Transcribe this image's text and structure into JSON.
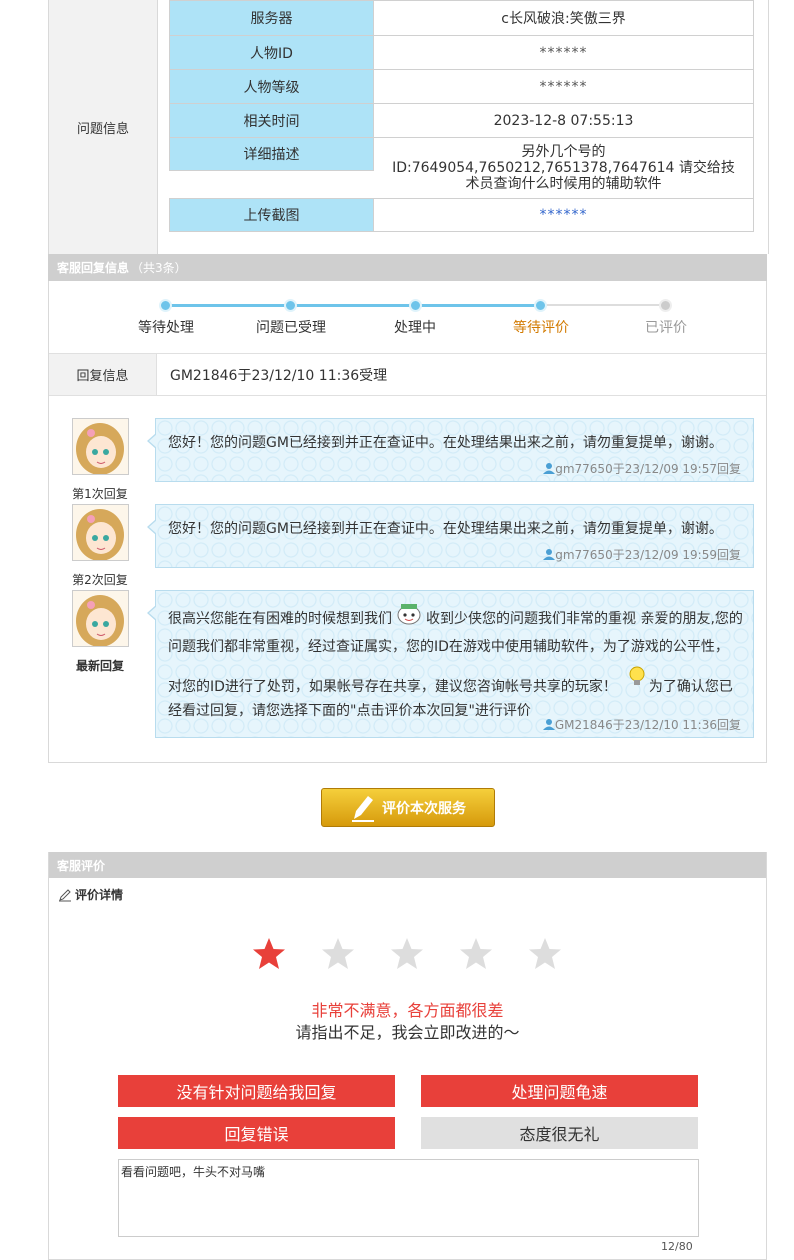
{
  "question": {
    "section_label": "问题信息",
    "rows": [
      {
        "key": "服务器",
        "value": "c长风破浪:笑傲三界"
      },
      {
        "key": "人物ID",
        "value": "******"
      },
      {
        "key": "人物等级",
        "value": "******"
      },
      {
        "key": "相关时间",
        "value": "2023-12-8 07:55:13"
      },
      {
        "key": "详细描述",
        "value_lines": [
          "另外几个号的",
          "ID:7649054,7650212,7651378,7647614 请交给技",
          "术员查询什么时候用的辅助软件"
        ]
      },
      {
        "key": "上传截图",
        "value": "******"
      }
    ]
  },
  "reply": {
    "header_title": "客服回复信息",
    "header_count": "（共3条）",
    "progress": {
      "steps": [
        "等待处理",
        "问题已受理",
        "处理中",
        "等待评价",
        "已评价"
      ],
      "current_step": 4
    },
    "info_label": "回复信息",
    "info_value": "GM21846于23/12/10 11:36受理",
    "messages": [
      {
        "label": "第1次回复",
        "text": "您好！您的问题GM已经接到并正在查证中。在处理结果出来之前，请勿重复提单，谢谢。",
        "author": "gm77650",
        "meta": "于23/12/09 19:57回复"
      },
      {
        "label": "第2次回复",
        "text": "您好！您的问题GM已经接到并正在查证中。在处理结果出来之前，请勿重复提单，谢谢。",
        "author": "gm77650",
        "meta": "于23/12/09 19:59回复"
      },
      {
        "label": "最新回复",
        "line1a": "很高兴您能在有困难的时候想到我们",
        "line1b": "收到少侠您的问题我们非常的重视 亲爱的朋友,您的",
        "line2": "问题我们都非常重视，经过查证属实，您的ID在游戏中使用辅助软件，为了游戏的公平性，",
        "line3a": "对您的ID进行了处罚，如果帐号存在共享，建议您咨询帐号共享的玩家！",
        "line3b": "为了确认您已",
        "line4": "经看过回复，请您选择下面的\"点击评价本次回复\"进行评价",
        "author": "GM21846",
        "meta": "于23/12/10 11:36回复"
      }
    ]
  },
  "rate_button_label": "评价本次服务",
  "evaluation": {
    "header_title": "客服评价",
    "detail_title": "评价详情",
    "rating": 1,
    "max_rating": 5,
    "rating_text": "非常不满意，各方面都很差",
    "rating_subtext": "请指出不足，我会立即改进的～",
    "tags": [
      {
        "label": "没有针对问题给我回复",
        "selected": true
      },
      {
        "label": "处理问题龟速",
        "selected": true
      },
      {
        "label": "回复错误",
        "selected": true
      },
      {
        "label": "态度很无礼",
        "selected": false
      }
    ],
    "comment": "看看问题吧，牛头不对马嘴",
    "comment_count": "12/80"
  },
  "colors": {
    "label_bg": "#aee3f7",
    "progress": "#6ec4ea",
    "current_step": "#d27a00",
    "rating_red": "#e8403a",
    "button_gold": "#e0b020"
  },
  "icons": [
    "user-icon",
    "pencil-icon",
    "edit-icon",
    "star-icon",
    "emoji-icon",
    "lightbulb-icon"
  ]
}
